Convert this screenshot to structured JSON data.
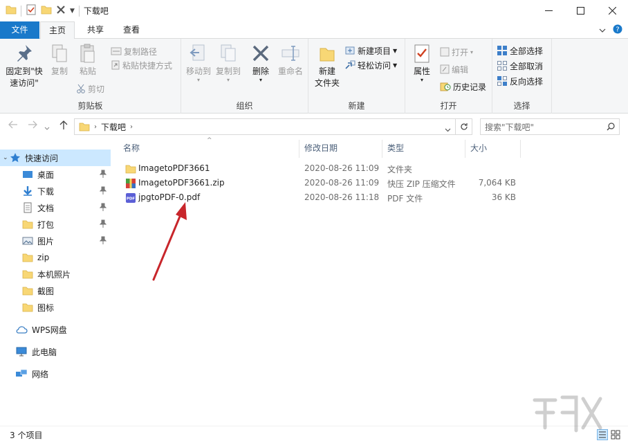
{
  "window": {
    "title": "下载吧"
  },
  "ribbon_tabs": {
    "file": "文件",
    "home": "主页",
    "share": "共享",
    "view": "查看"
  },
  "ribbon": {
    "clipboard": {
      "label": "剪贴板",
      "pin_quick_access_l1": "固定到\"快",
      "pin_quick_access_l2": "速访问\"",
      "copy": "复制",
      "paste": "粘贴",
      "copy_path": "复制路径",
      "paste_shortcut": "粘贴快捷方式",
      "cut": "剪切"
    },
    "organize": {
      "label": "组织",
      "move_to": "移动到",
      "copy_to": "复制到",
      "delete": "删除",
      "rename": "重命名"
    },
    "new": {
      "label": "新建",
      "new_folder_l1": "新建",
      "new_folder_l2": "文件夹",
      "new_item": "新建项目",
      "easy_access": "轻松访问"
    },
    "open": {
      "label": "打开",
      "properties": "属性",
      "open": "打开",
      "edit": "编辑",
      "history": "历史记录"
    },
    "select": {
      "label": "选择",
      "select_all": "全部选择",
      "select_none": "全部取消",
      "invert": "反向选择"
    }
  },
  "address": {
    "path_segment": "下载吧",
    "search_placeholder": "搜索\"下载吧\""
  },
  "sidebar": {
    "quick_access": "快速访问",
    "items": [
      {
        "label": "桌面"
      },
      {
        "label": "下载"
      },
      {
        "label": "文档"
      },
      {
        "label": "打包"
      },
      {
        "label": "图片"
      },
      {
        "label": "zip"
      },
      {
        "label": "本机照片"
      },
      {
        "label": "截图"
      },
      {
        "label": "图标"
      }
    ],
    "wps": "WPS网盘",
    "this_pc": "此电脑",
    "network": "网络"
  },
  "columns": {
    "name": "名称",
    "date": "修改日期",
    "type": "类型",
    "size": "大小"
  },
  "files": [
    {
      "name": "ImagetoPDF3661",
      "date": "2020-08-26 11:09",
      "type": "文件夹",
      "size": ""
    },
    {
      "name": "ImagetoPDF3661.zip",
      "date": "2020-08-26 11:09",
      "type": "快压 ZIP 压缩文件",
      "size": "7,064 KB"
    },
    {
      "name": "jpgtoPDF-0.pdf",
      "date": "2020-08-26 11:18",
      "type": "PDF 文件",
      "size": "36 KB"
    }
  ],
  "status": {
    "count": "3 个项目"
  },
  "colors": {
    "accent": "#1979ca",
    "selected_bg": "#cce8ff",
    "folder": "#f8d775",
    "arrow": "#c8262b"
  }
}
